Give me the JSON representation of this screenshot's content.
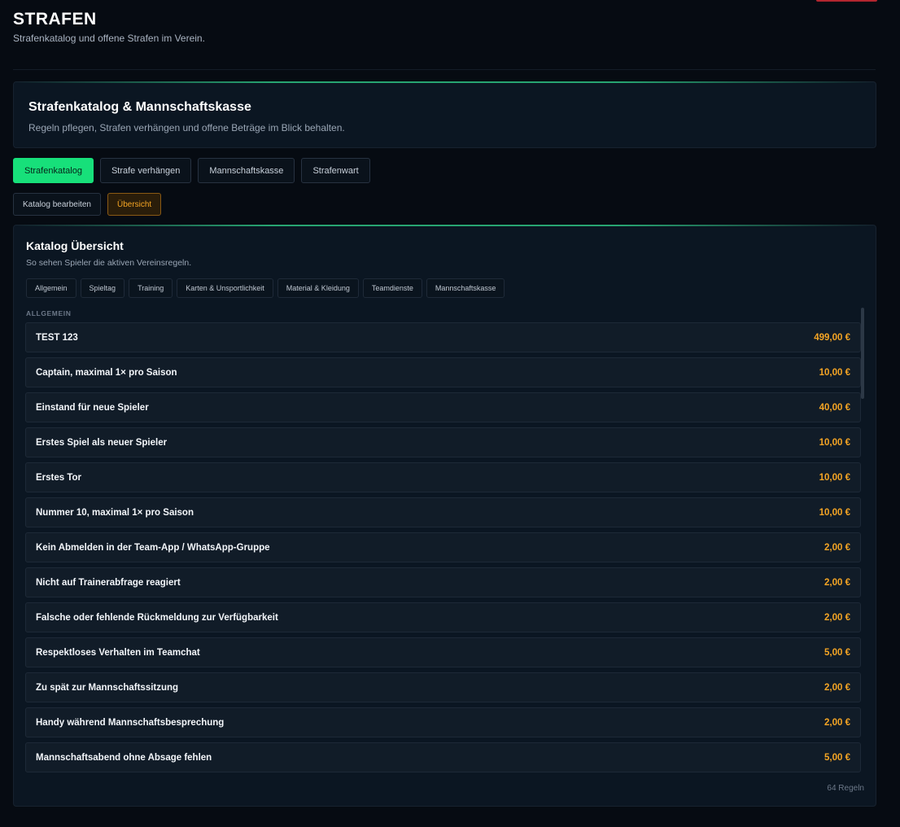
{
  "page": {
    "title": "STRAFEN",
    "subtitle": "Strafenkatalog und offene Strafen im Verein."
  },
  "header": {
    "title": "Strafenkatalog & Mannschaftskasse",
    "subtitle": "Regeln pflegen, Strafen verhängen und offene Beträge im Blick behalten."
  },
  "tabs": [
    {
      "label": "Strafenkatalog",
      "active": true
    },
    {
      "label": "Strafe verhängen",
      "active": false
    },
    {
      "label": "Mannschaftskasse",
      "active": false
    },
    {
      "label": "Strafenwart",
      "active": false
    }
  ],
  "subtabs": [
    {
      "label": "Katalog bearbeiten",
      "active": false
    },
    {
      "label": "Übersicht",
      "active": true
    }
  ],
  "catalog": {
    "title": "Katalog Übersicht",
    "subtitle": "So sehen Spieler die aktiven Vereinsregeln.",
    "categories": [
      "Allgemein",
      "Spieltag",
      "Training",
      "Karten & Unsportlichkeit",
      "Material & Kleidung",
      "Teamdienste",
      "Mannschaftskasse"
    ],
    "section_label": "ALLGEMEIN",
    "rules": [
      {
        "name": "TEST 123",
        "amount": "499,00 €"
      },
      {
        "name": "Captain, maximal 1× pro Saison",
        "amount": "10,00 €"
      },
      {
        "name": "Einstand für neue Spieler",
        "amount": "40,00 €"
      },
      {
        "name": "Erstes Spiel als neuer Spieler",
        "amount": "10,00 €"
      },
      {
        "name": "Erstes Tor",
        "amount": "10,00 €"
      },
      {
        "name": "Nummer 10, maximal 1× pro Saison",
        "amount": "10,00 €"
      },
      {
        "name": "Kein Abmelden in der Team-App / WhatsApp-Gruppe",
        "amount": "2,00 €"
      },
      {
        "name": "Nicht auf Trainerabfrage reagiert",
        "amount": "2,00 €"
      },
      {
        "name": "Falsche oder fehlende Rückmeldung zur Verfügbarkeit",
        "amount": "2,00 €"
      },
      {
        "name": "Respektloses Verhalten im Teamchat",
        "amount": "5,00 €"
      },
      {
        "name": "Zu spät zur Mannschaftssitzung",
        "amount": "2,00 €"
      },
      {
        "name": "Handy während Mannschaftsbesprechung",
        "amount": "2,00 €"
      },
      {
        "name": "Mannschaftsabend ohne Absage fehlen",
        "amount": "5,00 €"
      }
    ],
    "count_label": "64 Regeln"
  },
  "colors": {
    "accent_green": "#17e07a",
    "amount_orange": "#f5a524",
    "background": "#060b12"
  }
}
